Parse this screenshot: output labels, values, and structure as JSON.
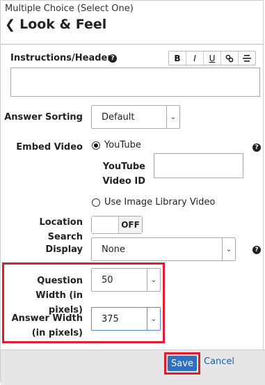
{
  "header": {
    "subtitle": "Multiple Choice (Select One)",
    "title": "Look & Feel",
    "back_icon": "chevron-left-icon"
  },
  "instructions": {
    "label": "Instructions/Header",
    "toolbar": [
      "B",
      "I",
      "U",
      "🔗",
      "≡"
    ],
    "value": ""
  },
  "answer_sorting": {
    "label": "Answer Sorting",
    "value": "Default"
  },
  "embed_video": {
    "label": "Embed Video",
    "option_youtube": "YouTube",
    "youtube_id_label": "YouTube Video ID",
    "youtube_id_value": "",
    "option_library": "Use Image Library Video",
    "selected": "YouTube"
  },
  "location_search": {
    "label": "Location Search",
    "state": "OFF"
  },
  "display": {
    "label": "Display",
    "value": "None"
  },
  "question_width": {
    "label": "Question Width (in pixels)",
    "value": "50"
  },
  "answer_width": {
    "label": "Answer Width (in pixels)",
    "value": "375"
  },
  "footer": {
    "save_label": "Save",
    "cancel_label": "Cancel"
  },
  "colors": {
    "highlight": "#e01d2a",
    "save_bg": "#2e6fbf",
    "link": "#1f5fae"
  }
}
